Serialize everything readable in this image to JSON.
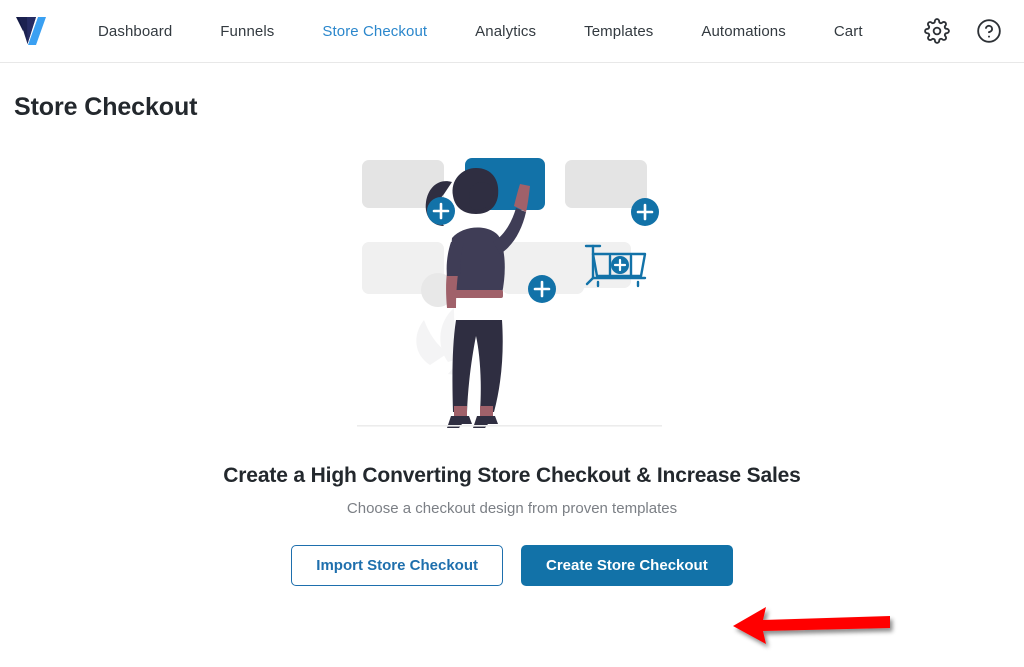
{
  "navbar": {
    "logo_icon": "wfunnels-logo-icon",
    "links": [
      {
        "label": "Dashboard",
        "active": false
      },
      {
        "label": "Funnels",
        "active": false
      },
      {
        "label": "Store Checkout",
        "active": true
      },
      {
        "label": "Analytics",
        "active": false
      },
      {
        "label": "Templates",
        "active": false
      },
      {
        "label": "Automations",
        "active": false
      },
      {
        "label": "Cart",
        "active": false
      }
    ],
    "actions": [
      {
        "icon": "gear-icon",
        "label": "Settings"
      },
      {
        "icon": "help-circle-icon",
        "label": "Help"
      }
    ]
  },
  "page": {
    "title": "Store Checkout"
  },
  "empty_state": {
    "illustration_name": "woman-arranging-checkout-blocks-illustration",
    "headline": "Create a High Converting Store Checkout & Increase Sales",
    "subtext": "Choose a checkout design from proven templates",
    "buttons": {
      "import_label": "Import Store Checkout",
      "create_label": "Create Store Checkout"
    }
  },
  "annotation": {
    "arrow_name": "red-arrow-pointing-left",
    "color": "#ff0000",
    "points_to": "Create Store Checkout"
  },
  "colors": {
    "accent_blue": "#1272a8",
    "link_blue": "#2b87cc",
    "text_dark": "#23282d",
    "text_muted": "#7b7f85",
    "nav_text": "#333a40",
    "box_gray": "#e4e4e4",
    "box_gray_light": "#f0f0f0",
    "figure_dark": "#3f3d56",
    "figure_pants": "#2f2e41",
    "figure_skin": "#a0616a"
  }
}
